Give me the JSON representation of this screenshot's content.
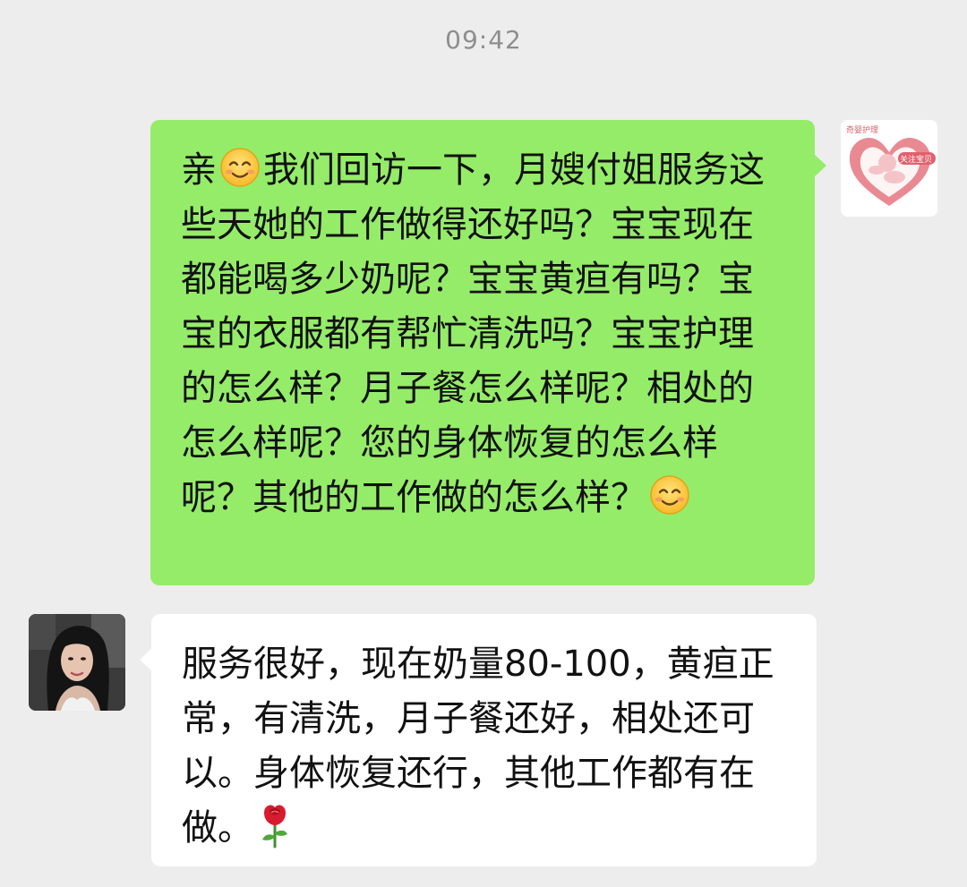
{
  "chat": {
    "timestamp": "09:42",
    "messages": [
      {
        "sender": "self",
        "avatar_icon": "heart-angel-logo-icon",
        "avatar_brand_text": "奇婴护理",
        "avatar_badge_text": "关注宝贝",
        "segments": [
          "亲",
          "我们回访一下，月嫂付姐服务这些天她的工作做得还好吗？宝宝现在都能喝多少奶呢？宝宝黄疸有吗？宝宝的衣服都有帮忙清洗吗？宝宝护理的怎么样？月子餐怎么样呢？相处的怎么样呢？您的身体恢复的怎么样呢？其他的工作做的怎么样？"
        ],
        "emojis": [
          "smiling-face-emoji",
          "smiling-face-emoji"
        ],
        "bubble_color": "#95ec69"
      },
      {
        "sender": "other",
        "avatar_icon": "woman-portrait-avatar",
        "text": "服务很好，现在奶量80-100，黄疸正常，有清洗，月子餐还好，相处还可以。身体恢复还行，其他工作都有在做。",
        "emojis": [
          "rose-emoji"
        ],
        "bubble_color": "#ffffff"
      }
    ]
  },
  "colors": {
    "background": "#ededed",
    "self_bubble": "#95ec69",
    "other_bubble": "#ffffff",
    "timestamp": "#8e8e8e"
  }
}
